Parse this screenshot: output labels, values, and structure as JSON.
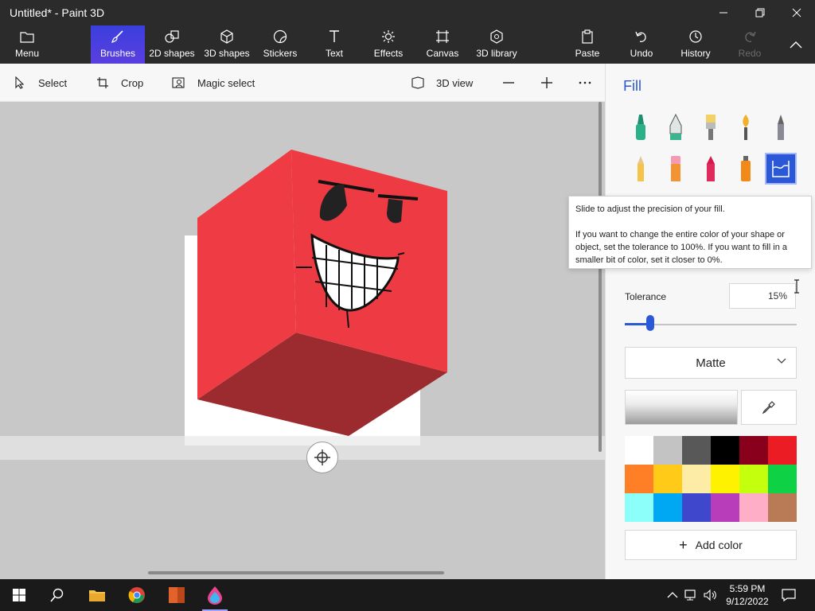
{
  "window": {
    "title": "Untitled* - Paint 3D"
  },
  "ribbon": {
    "items": [
      {
        "label": "Menu",
        "icon": "folder-icon"
      },
      {
        "label": "Brushes",
        "icon": "brush-icon",
        "active": true
      },
      {
        "label": "2D shapes",
        "icon": "shapes-2d-icon"
      },
      {
        "label": "3D shapes",
        "icon": "cube-icon"
      },
      {
        "label": "Stickers",
        "icon": "sticker-icon"
      },
      {
        "label": "Text",
        "icon": "text-icon"
      },
      {
        "label": "Effects",
        "icon": "effects-icon"
      },
      {
        "label": "Canvas",
        "icon": "canvas-icon"
      },
      {
        "label": "3D library",
        "icon": "library-3d-icon"
      },
      {
        "label": "Paste",
        "icon": "paste-icon"
      },
      {
        "label": "Undo",
        "icon": "undo-icon"
      },
      {
        "label": "History",
        "icon": "history-icon"
      },
      {
        "label": "Redo",
        "icon": "redo-icon",
        "disabled": true
      }
    ]
  },
  "toolbar": {
    "select_label": "Select",
    "crop_label": "Crop",
    "magic_select_label": "Magic select",
    "view3d_label": "3D view"
  },
  "panel": {
    "title": "Fill",
    "brushes": [
      "marker-icon",
      "calligraphy-pen-icon",
      "oil-brush-icon",
      "watercolor-icon",
      "pixel-pen-icon",
      "pencil-icon",
      "eraser-icon",
      "crayon-icon",
      "spray-can-icon",
      "fill-bucket-icon"
    ],
    "selected_brush": "fill-bucket-icon",
    "tolerance_label": "Tolerance",
    "tolerance_value": "15%",
    "tolerance_fraction": 0.15,
    "material": "Matte",
    "palette": [
      "#FFFFFF",
      "#C3C3C3",
      "#585858",
      "#000000",
      "#88001B",
      "#EC1C24",
      "#FF7F27",
      "#FFCA18",
      "#FDECA6",
      "#FFF200",
      "#C4FF0E",
      "#0ED145",
      "#8CFFFB",
      "#00A8F3",
      "#3F48CC",
      "#B83DBA",
      "#FFAEC8",
      "#B97A56"
    ],
    "add_color_label": "Add color"
  },
  "tooltip": {
    "line1": "Slide to adjust the precision of your fill.",
    "line2": "If you want to change the entire color of your shape or object, set the tolerance to 100%. If you want to fill in a smaller bit of color, set it closer to 0%."
  },
  "taskbar": {
    "time": "5:59 PM",
    "date": "9/12/2022"
  },
  "colors": {
    "accent": "#2B58D6",
    "active_tab": "#4A3FE0",
    "cube_face": "#EF3B43",
    "cube_bottom": "#9B2B2E"
  }
}
